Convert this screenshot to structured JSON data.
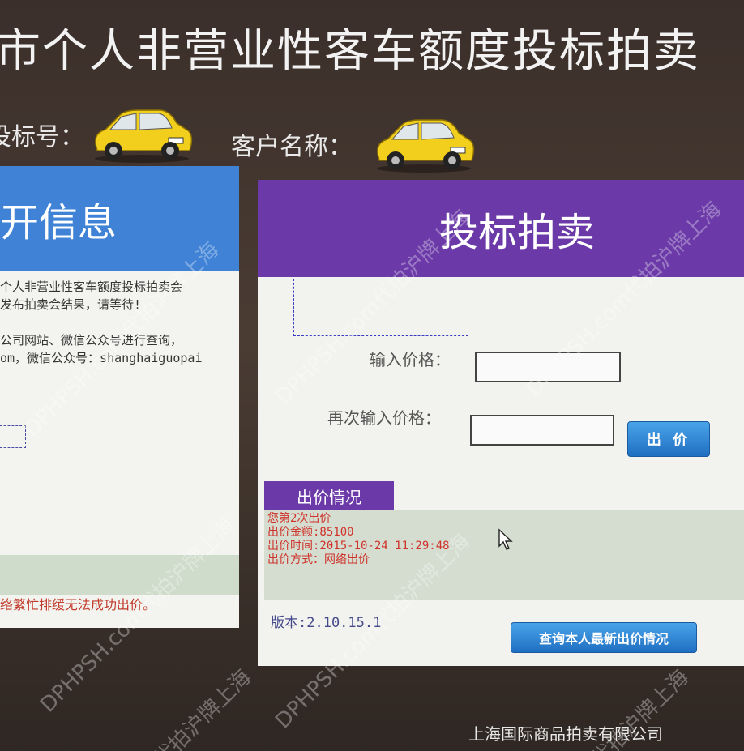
{
  "header": {
    "title": "市个人非营业性客车额度投标拍卖",
    "bid_number_label": "投标号：",
    "customer_name_label": "客户名称："
  },
  "left_panel": {
    "heading": "开信息",
    "lines": [
      "个人非营业性客车额度投标拍卖会",
      "发布拍卖会结果，请等待!",
      "公司网站、微信公众号进行查询，",
      "om，微信公众号：shanghaiguopai"
    ],
    "warning": "络繁忙排缓无法成功出价。"
  },
  "right_panel": {
    "heading": "投标拍卖",
    "price_label": "输入价格：",
    "confirm_price_label": "再次输入价格：",
    "price_value": "",
    "confirm_price_value": "",
    "bid_button": "出 价",
    "status_tab": "出价情况",
    "status": {
      "count": "您第2次出价",
      "amount": "出价金额:85100",
      "time": "出价时间:2015-10-24 11:29:48",
      "method": "出价方式：网络出价"
    },
    "version": "版本:2.10.15.1",
    "query_button": "查询本人最新出价情况"
  },
  "footer": {
    "company": "上海国际商品拍卖有限公司"
  },
  "watermarks": [
    "DPHPSH.com代拍沪牌上海",
    "DPHPSH.com代拍沪牌上海",
    "DPHPSH.com代拍沪牌上海",
    "DPHPSH.com代拍沪牌上海",
    "DPHPSH.com代拍沪牌上海",
    "代拍沪牌上海",
    "代拍沪牌上海"
  ],
  "colors": {
    "left_header": "#3f82d6",
    "right_header": "#6b3aa8",
    "status_text": "#d0332b",
    "button": "#2b80d0"
  },
  "icons": {
    "car": "yellow-car-icon",
    "cursor": "mouse-pointer-icon"
  }
}
